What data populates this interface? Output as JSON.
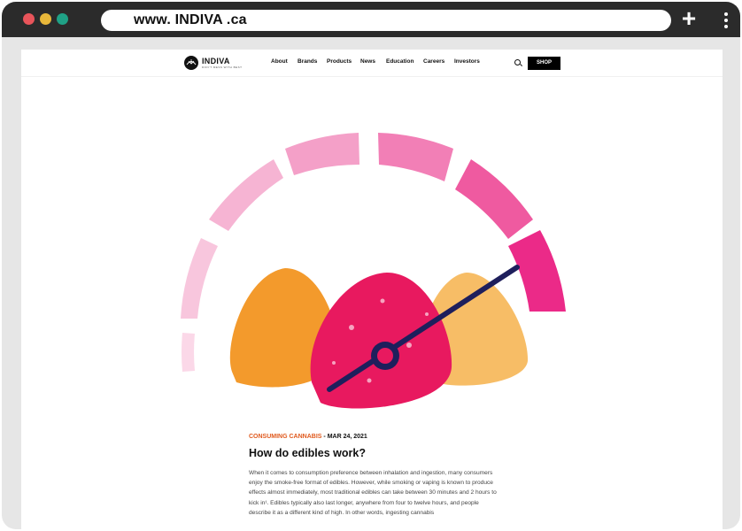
{
  "browser": {
    "url": "www. INDIVA .ca",
    "traffic_colors": [
      "#e8545a",
      "#e8b73a",
      "#1fa186"
    ],
    "new_tab_label": "+"
  },
  "site": {
    "logo_text": "INDIVA",
    "logo_tagline": "DON'T MESS WITH BEST",
    "nav": [
      "About",
      "Brands",
      "Products",
      "News",
      "Education",
      "Careers",
      "Investors"
    ],
    "shop_label": "SHOP",
    "icons": [
      "search-icon",
      "menu-kebab-icon",
      "plus-icon"
    ]
  },
  "hero": {
    "description_colors": {
      "gauge_light": "#f7c4dc",
      "gauge_mid": "#f28ec0",
      "gauge_dark": "#ec2d8c",
      "needle": "#1e1f5c",
      "gummy_orange": "#f39a2c",
      "gummy_pink": "#e8195f",
      "gummy_peach": "#f7b85e"
    }
  },
  "article": {
    "category": "CONSUMING CANNABIS",
    "separator": " - ",
    "date": "MAR 24, 2021",
    "title": "How do edibles work?",
    "body": "When it comes to consumption preference between inhalation and ingestion, many consumers enjoy the smoke-free format of edibles. However, while smoking or vaping is known to produce effects almost immediately, most traditional edibles can take between 30 minutes and 2 hours to kick in¹. Edibles typically also last longer, anywhere from four to twelve hours, and people describe it as a different kind of high. In other words, ingesting cannabis"
  }
}
